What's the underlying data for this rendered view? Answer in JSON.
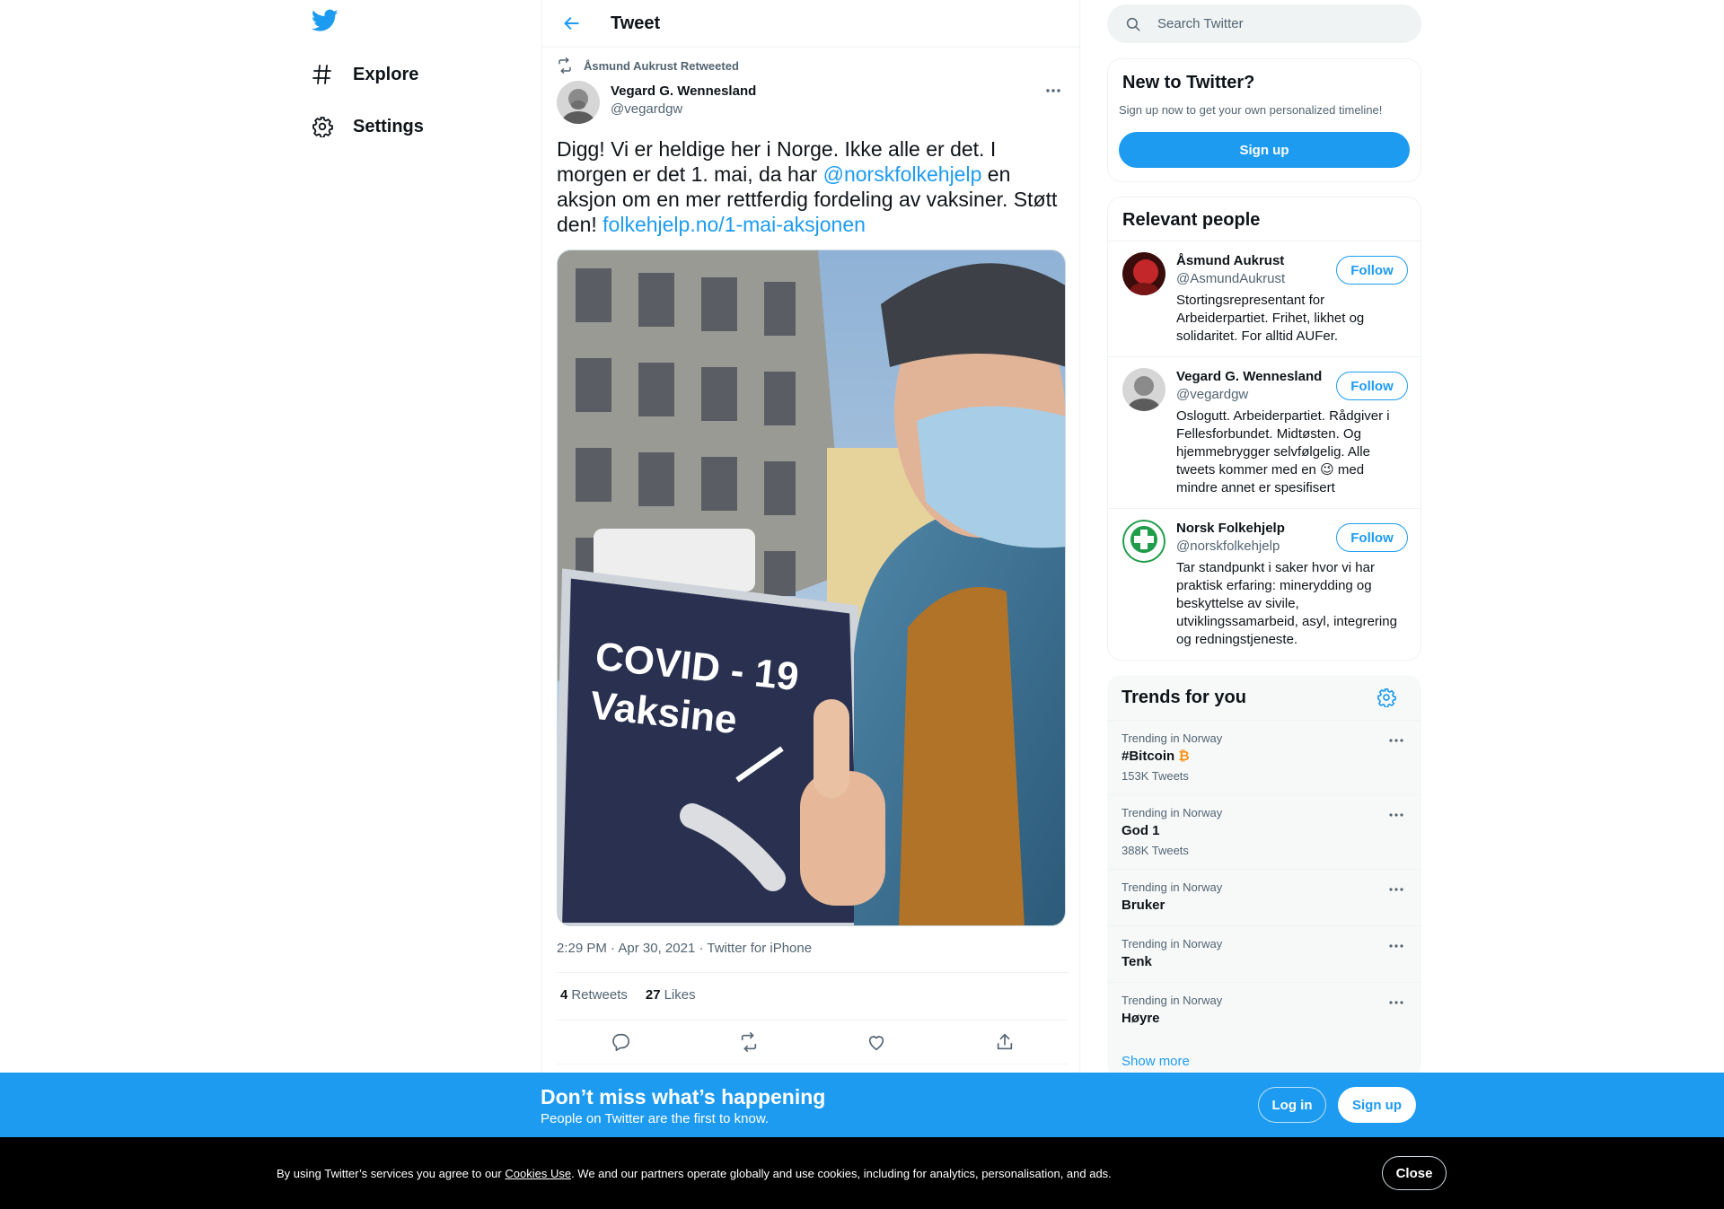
{
  "nav": {
    "logo": "twitter-bird-icon",
    "items": [
      {
        "icon": "hashtag-icon",
        "label": "Explore"
      },
      {
        "icon": "gear-icon",
        "label": "Settings"
      }
    ]
  },
  "header": {
    "back_icon": "arrow-left-icon",
    "title": "Tweet"
  },
  "tweet": {
    "context": "Åsmund Aukrust Retweeted",
    "author_name": "Vegard G. Wennesland",
    "author_handle": "@vegardgw",
    "text_1": "Digg! Vi er heldige her i Norge. Ikke alle er det. I morgen er det 1. mai, da har ",
    "mention": "@norskfolkehjelp",
    "text_2": " en aksjon om en mer rettferdig fordeling av vaksiner. Støtt den! ",
    "link": "folkehjelp.no/1-mai-aksjonen",
    "photo_sign_line1": "COVID - 19",
    "photo_sign_line2": "Vaksine",
    "time": "2:29 PM",
    "date": "Apr 30, 2021",
    "source": "Twitter for iPhone",
    "retweets_count": "4",
    "retweets_label": "Retweets",
    "likes_count": "27",
    "likes_label": "Likes"
  },
  "search": {
    "placeholder": "Search Twitter"
  },
  "new_to_twitter": {
    "title": "New to Twitter?",
    "subtitle": "Sign up now to get your own personalized timeline!",
    "button": "Sign up"
  },
  "relevant_people": {
    "title": "Relevant people",
    "follow_label": "Follow",
    "people": [
      {
        "name": "Åsmund Aukrust",
        "handle": "@AsmundAukrust",
        "bio": "Stortingsrepresentant for Arbeiderpartiet. Frihet, likhet og solidaritet. For alltid AUFer."
      },
      {
        "name": "Vegard G. Wennesland",
        "handle": "@vegardgw",
        "bio_1": "Oslogutt. Arbeiderpartiet. Rådgiver i Fellesforbundet. Midtøsten. Og hjemmebrygger selvfølgelig. Alle tweets kommer med en ",
        "bio_emoji": "😉",
        "bio_2": " med mindre annet er spesifisert"
      },
      {
        "name": "Norsk Folkehjelp",
        "handle": "@norskfolkehjelp",
        "bio": "Tar standpunkt i saker hvor vi har praktisk erfaring: minerydding og beskyttelse av sivile, utviklingssamarbeid, asyl, integrering og redningstjeneste."
      }
    ]
  },
  "trends": {
    "title": "Trends for you",
    "items": [
      {
        "context": "Trending in Norway",
        "name": "#Bitcoin",
        "emoji": "₿",
        "count": "153K Tweets"
      },
      {
        "context": "Trending in Norway",
        "name": "God 1",
        "count": "388K Tweets"
      },
      {
        "context": "Trending in Norway",
        "name": "Bruker"
      },
      {
        "context": "Trending in Norway",
        "name": "Tenk"
      },
      {
        "context": "Trending in Norway",
        "name": "Høyre"
      }
    ],
    "show_more": "Show more"
  },
  "banner": {
    "title": "Don’t miss what’s happening",
    "subtitle": "People on Twitter are the first to know.",
    "login": "Log in",
    "signup": "Sign up"
  },
  "cookie": {
    "text_1": "By using Twitter’s services you agree to our ",
    "link": "Cookies Use",
    "text_2": ". We and our partners operate globally and use cookies, including for analytics, personalisation, and ads.",
    "close": "Close"
  },
  "colors": {
    "accent": "#1d9bf0",
    "text": "#0f1419",
    "secondary": "#536471",
    "cookie_bg": "#000000"
  }
}
